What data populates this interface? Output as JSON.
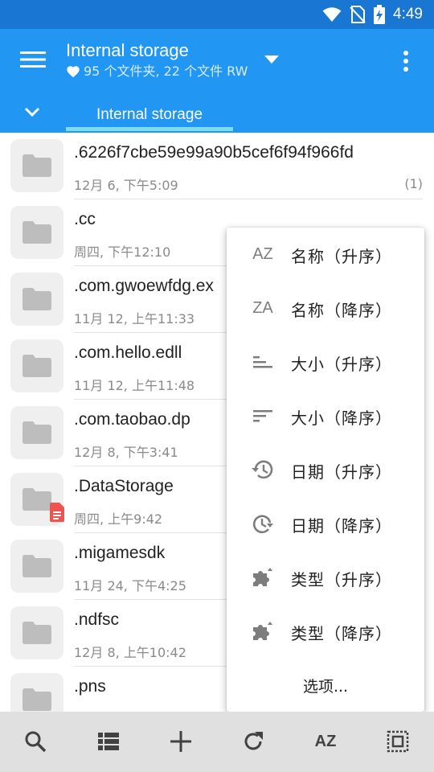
{
  "status_bar": {
    "time": "4:49",
    "icons": [
      "wifi-icon",
      "no-sim-icon",
      "battery-charging-icon"
    ]
  },
  "app_bar": {
    "title": "Internal storage",
    "subtitle": "95 个文件夹, 22 个文件 RW",
    "subtitle_icon": "heart-icon",
    "tab_label": "Internal storage",
    "primary_color": "#2196f3",
    "status_color": "#1976d2",
    "tab_indicator_color": "#7fdcec"
  },
  "files": [
    {
      "name": ".6226f7cbe59e99a90b5cef6f94f966fd",
      "date": "12月 6, 下午5:09",
      "count": "(1)"
    },
    {
      "name": ".cc",
      "date": "周四, 下午12:10"
    },
    {
      "name": ".com.gwoewfdg.ex",
      "date": "11月 12, 上午11:33"
    },
    {
      "name": ".com.hello.edll",
      "date": "11月 12, 上午11:48"
    },
    {
      "name": ".com.taobao.dp",
      "date": "12月 8, 下午3:41"
    },
    {
      "name": ".DataStorage",
      "date": "周四, 上午9:42",
      "badge": "document-badge-icon",
      "badge_color": "#ef5350"
    },
    {
      "name": ".migamesdk",
      "date": "11月 24, 下午4:25"
    },
    {
      "name": ".ndfsc",
      "date": "12月 8, 上午10:42"
    },
    {
      "name": ".pns",
      "date": ""
    }
  ],
  "sort_menu": {
    "items": [
      {
        "icon_text": "AZ",
        "icon": "sort-az-icon",
        "label": "名称（升序）"
      },
      {
        "icon_text": "ZA",
        "icon": "sort-za-icon",
        "label": "名称（降序）"
      },
      {
        "icon": "size-ascending-icon",
        "label": "大小（升序）"
      },
      {
        "icon": "size-descending-icon",
        "label": "大小（降序）"
      },
      {
        "icon": "history-icon",
        "label": "日期（升序）"
      },
      {
        "icon": "clock-forward-icon",
        "label": "日期（降序）"
      },
      {
        "icon": "puzzle-ascending-icon",
        "label": "类型（升序）"
      },
      {
        "icon": "puzzle-descending-icon",
        "label": "类型（降序）"
      }
    ],
    "options_label": "选项..."
  },
  "bottom_bar": {
    "buttons": [
      "search-icon",
      "list-view-icon",
      "add-icon",
      "refresh-icon",
      "sort-az-icon",
      "select-all-icon"
    ],
    "sort_label": "AZ"
  }
}
